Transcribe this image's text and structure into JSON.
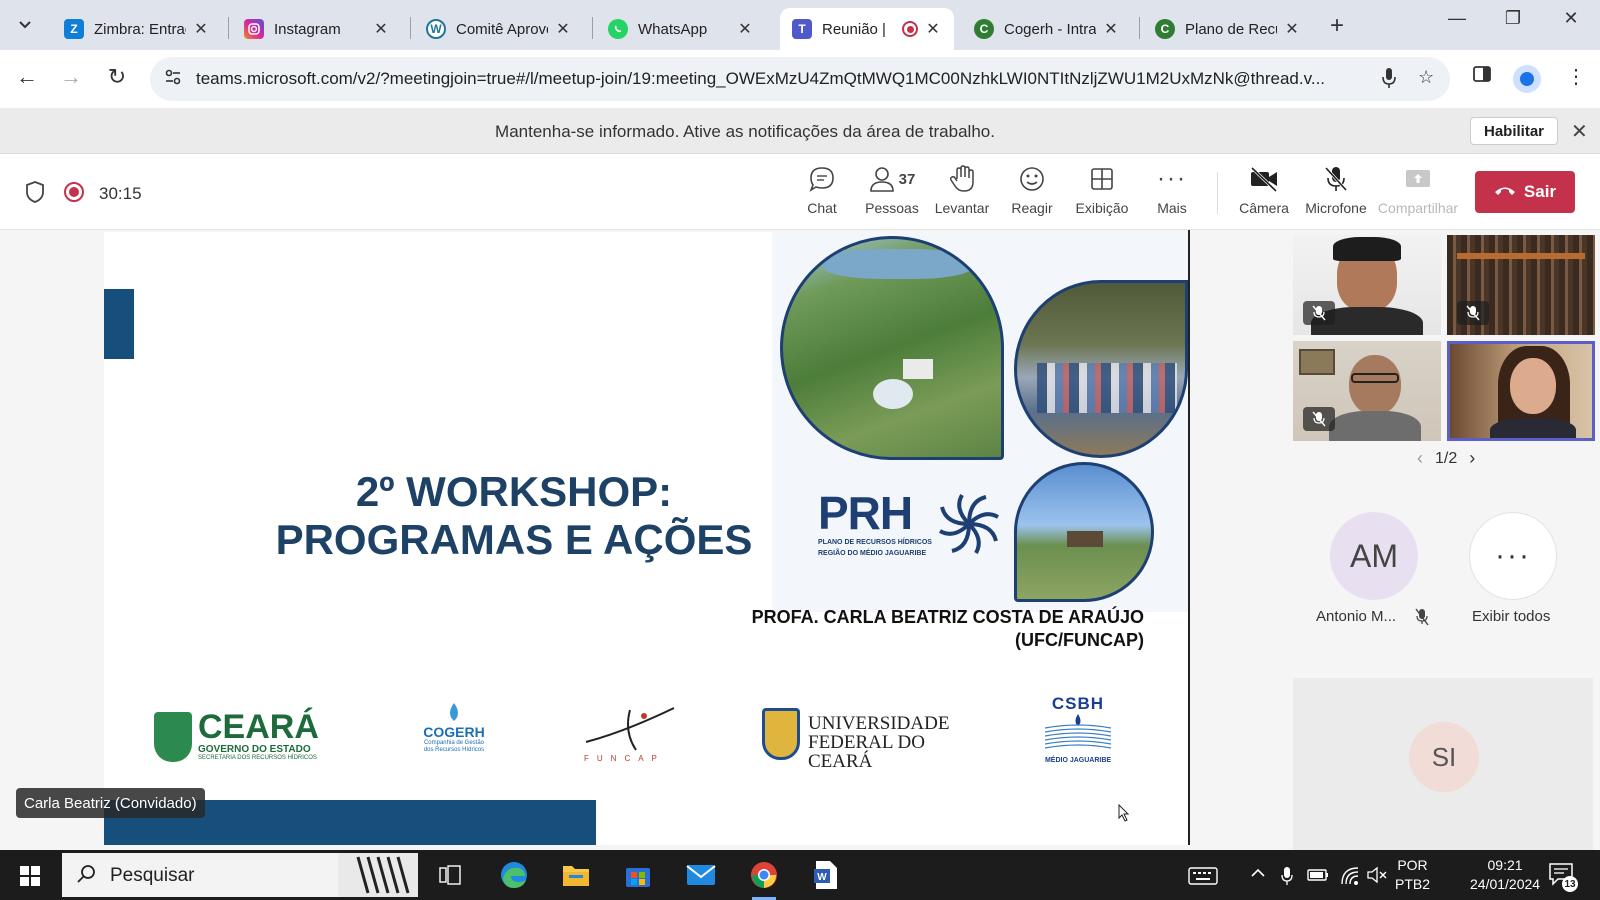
{
  "browser": {
    "tabs": [
      {
        "label": "Zimbra: Entrad",
        "icon": "zimbra-icon",
        "color": "#0f7ed6"
      },
      {
        "label": "Instagram",
        "icon": "instagram-icon",
        "color": "#d6249f"
      },
      {
        "label": "Comitê Aprove",
        "icon": "wordpress-icon",
        "color": "#21759b"
      },
      {
        "label": "WhatsApp",
        "icon": "whatsapp-icon",
        "color": "#25d366"
      },
      {
        "label": "Reunião | ",
        "icon": "teams-icon",
        "color": "#5059c9",
        "active": true,
        "recording": true
      },
      {
        "label": "Cogerh - Intra",
        "icon": "cogerh-icon",
        "color": "#2e7d32"
      },
      {
        "label": "Plano de Recu",
        "icon": "cogerh-icon",
        "color": "#2e7d32"
      }
    ],
    "url": "teams.microsoft.com/v2/?meetingjoin=true#/l/meetup-join/19:meeting_OWExMzU4ZmQtMWQ1MC00NzhkLWI0NTItNzljZWU1M2UxMzNk@thread.v..."
  },
  "notification": {
    "text": "Mantenha-se informado. Ative as notificações da área de trabalho.",
    "button": "Habilitar"
  },
  "meeting": {
    "timer": "30:15",
    "controls": {
      "chat": "Chat",
      "people": "Pessoas",
      "people_count": "37",
      "raise": "Levantar",
      "react": "Reagir",
      "view": "Exibição",
      "more": "Mais",
      "camera": "Câmera",
      "mic": "Microfone",
      "share": "Compartilhar",
      "leave": "Sair"
    },
    "accent_color": "#c4314b"
  },
  "slide": {
    "title_line1": "2º WORKSHOP:",
    "title_line2": "PROGRAMAS E AÇÕES",
    "prh": "PRH",
    "prh_sub1": "PLANO DE RECURSOS HÍDRICOS",
    "prh_sub2": "REGIÃO DO MÉDIO JAGUARIBE",
    "presenter_line1": "PROFA. CARLA BEATRIZ COSTA DE ARAÚJO",
    "presenter_line2": "(UFC/FUNCAP)",
    "logos": {
      "ceara_big": "CEARÁ",
      "ceara_small": "GOVERNO DO ESTADO",
      "ceara_tiny": "SECRETARIA DOS RECURSOS HÍDRICOS",
      "cogerh": "COGERH",
      "cogerh_sub1": "Companhia de Gestão",
      "cogerh_sub2": "dos Recursos Hídricos",
      "funcap": "FUNCAP",
      "ufc_line1": "UNIVERSIDADE",
      "ufc_line2": "FEDERAL DO CEARÁ",
      "csbh": "CSBH",
      "csbh_sub": "MÉDIO JAGUARIBE"
    }
  },
  "presenter_tag": "Carla Beatriz (Convidado)",
  "participants": {
    "pager": "1/2",
    "am_initials": "AM",
    "am_name": "Antonio M...",
    "show_all": "Exibir todos",
    "si_initials": "SI"
  },
  "taskbar": {
    "search_placeholder": "Pesquisar",
    "lang_line1": "POR",
    "lang_line2": "PTB2",
    "time": "09:21",
    "date": "24/01/2024",
    "notification_count": "13"
  }
}
